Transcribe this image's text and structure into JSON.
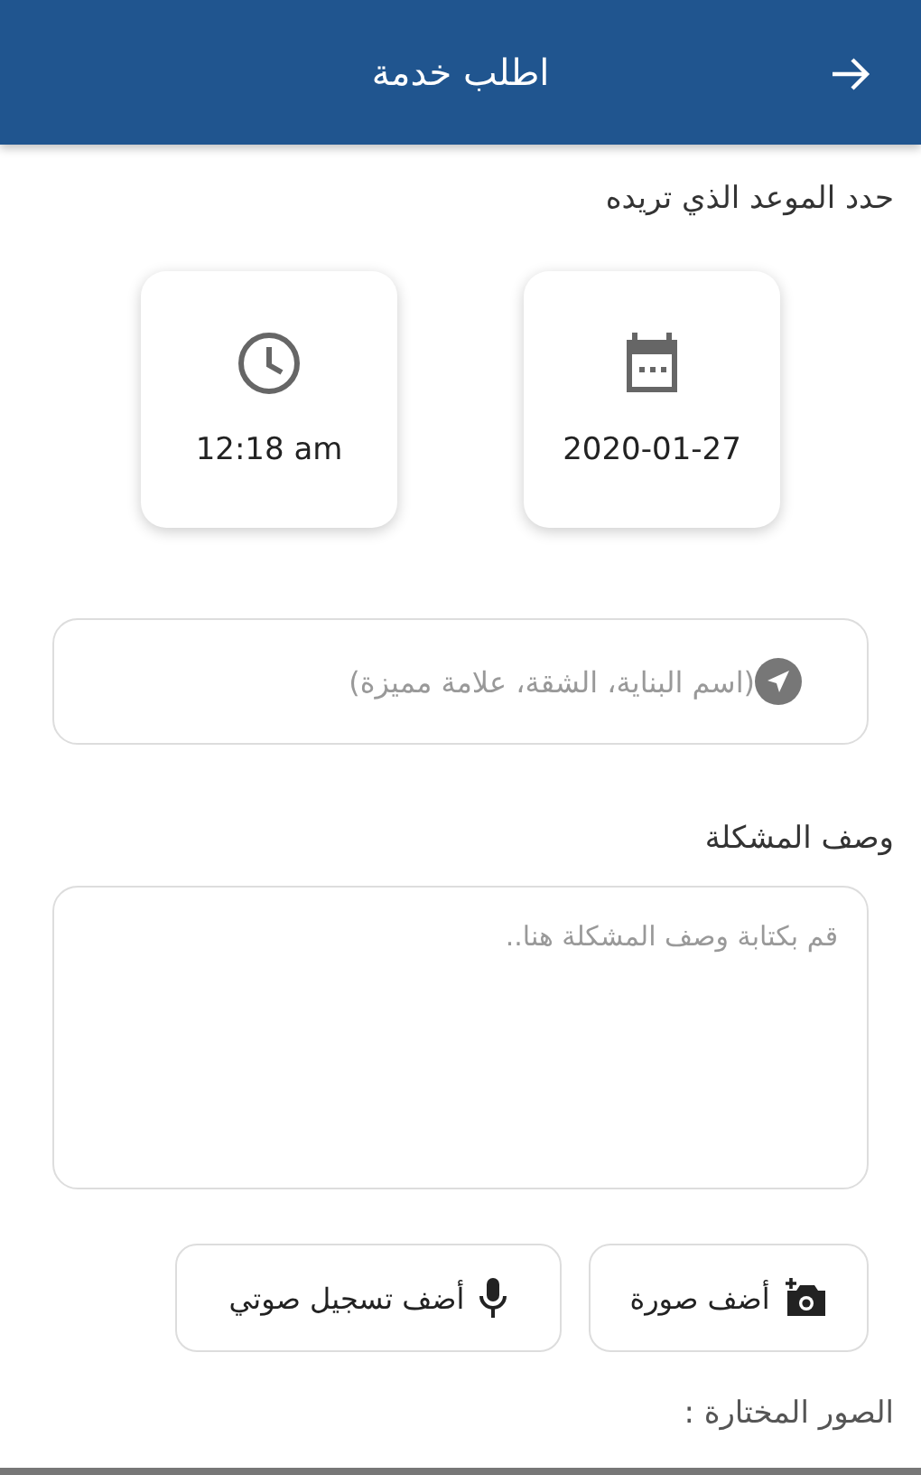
{
  "app_bar": {
    "title": "اطلب خدمة"
  },
  "schedule": {
    "label": "حدد الموعد الذي تريده",
    "pickers": [
      {
        "kind": "date",
        "value": "2020-01-27"
      },
      {
        "kind": "time",
        "value": "12:18 am"
      }
    ]
  },
  "location": {
    "placeholder": "(اسم البناية، الشقة، علامة مميزة)"
  },
  "description": {
    "label": "وصف المشكلة",
    "placeholder": "قم بكتابة وصف المشكلة هنا.."
  },
  "buttons": [
    {
      "kind": "photo",
      "label": "أضف صورة"
    },
    {
      "kind": "voice",
      "label": "أضف تسجيل صوتي"
    }
  ],
  "selected_photos": {
    "label": "الصور المختارة :"
  }
}
